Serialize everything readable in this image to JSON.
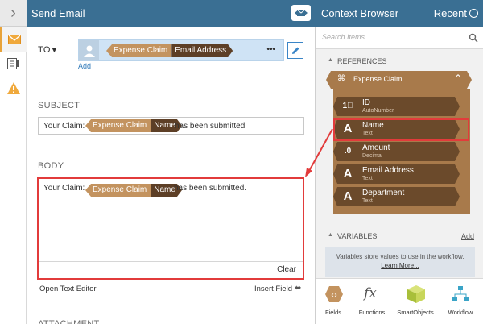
{
  "header": {
    "title": "Send Email"
  },
  "context": {
    "title": "Context Browser",
    "recent": "Recent",
    "search_placeholder": "Search Items",
    "references_label": "REFERENCES",
    "expense_claim": "Expense Claim",
    "items": [
      {
        "name": "ID",
        "type": "AutoNumber",
        "icon": "autonumber-icon"
      },
      {
        "name": "Name",
        "type": "Text",
        "icon": "text-icon"
      },
      {
        "name": "Amount",
        "type": "Decimal",
        "icon": "decimal-icon"
      },
      {
        "name": "Email Address",
        "type": "Text",
        "icon": "text-icon"
      },
      {
        "name": "Department",
        "type": "Text",
        "icon": "text-icon"
      }
    ],
    "variables_label": "VARIABLES",
    "add": "Add",
    "variables_desc": "Variables store values to use in the workflow.",
    "learn_more": "Learn More...",
    "tabs": [
      "Fields",
      "Functions",
      "SmartObjects",
      "Workflow"
    ]
  },
  "to": {
    "label": "TO",
    "tag_a": "Expense Claim",
    "tag_b": "Email Address",
    "more": "•••",
    "add": "Add"
  },
  "subject": {
    "label": "SUBJECT",
    "prefix": "Your Claim:",
    "tag_a": "Expense Claim",
    "tag_b": "Name",
    "suffix": "has been submitted"
  },
  "body": {
    "label": "BODY",
    "prefix": "Your Claim:",
    "tag_a": "Expense Claim",
    "tag_b": "Name",
    "suffix": "has been submitted.",
    "clear": "Clear"
  },
  "footer": {
    "open_editor": "Open Text Editor",
    "insert_field": "Insert Field",
    "attachments": "ATTACHMENT"
  },
  "colors": {
    "header": "#3a6f93",
    "highlight": "#e23b3b",
    "reference": "#6b4a2b",
    "tag_a": "#c3935f",
    "tag_b": "#5d3f26"
  }
}
